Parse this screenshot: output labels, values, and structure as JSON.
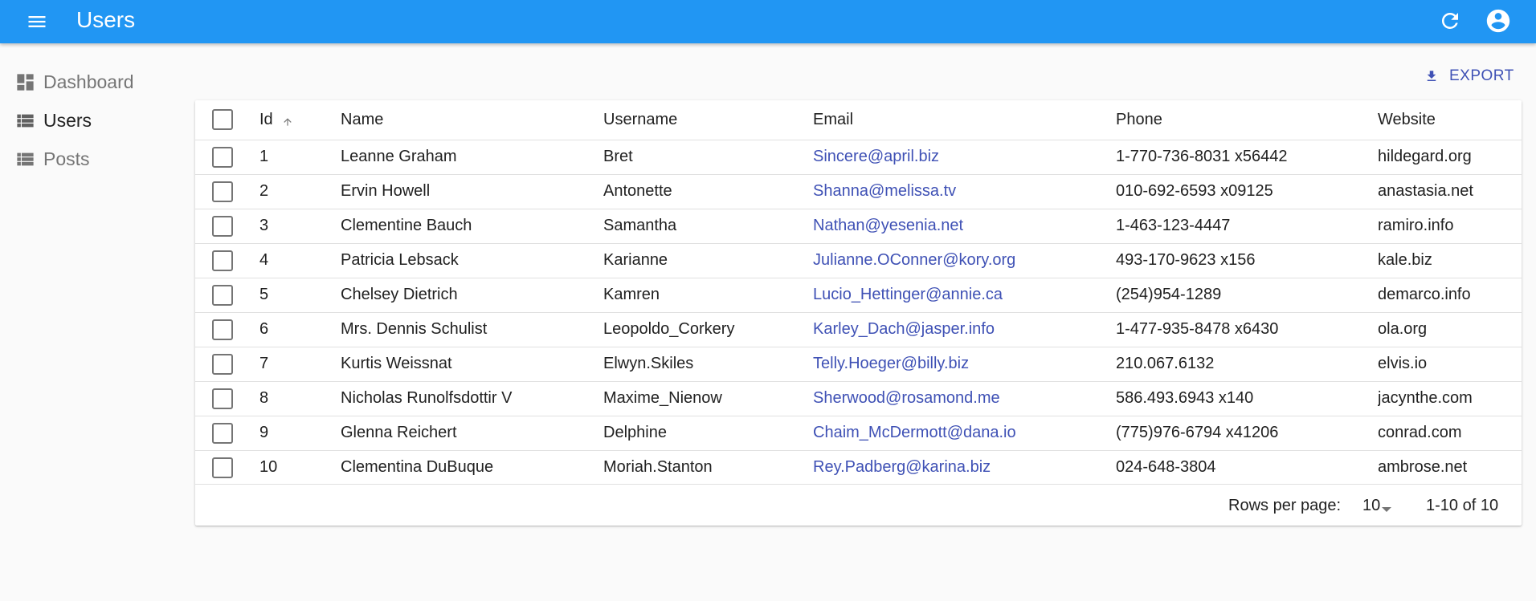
{
  "app": {
    "title": "Users",
    "icons": {
      "menu": "menu-icon",
      "refresh": "refresh-icon",
      "account": "account-circle-icon"
    },
    "colors": {
      "appbar": "#2196f3",
      "link": "#3f51b5"
    }
  },
  "sidebar": {
    "items": [
      {
        "label": "Dashboard",
        "icon": "dashboard-icon",
        "active": false
      },
      {
        "label": "Users",
        "icon": "list-icon",
        "active": true
      },
      {
        "label": "Posts",
        "icon": "list-icon",
        "active": false
      }
    ]
  },
  "toolbar": {
    "export_label": "EXPORT",
    "export_icon": "download-icon"
  },
  "table": {
    "headers": {
      "id": "Id",
      "name": "Name",
      "username": "Username",
      "email": "Email",
      "phone": "Phone",
      "website": "Website"
    },
    "sort": {
      "column": "id",
      "direction": "ascending"
    },
    "rows": [
      {
        "id": "1",
        "name": "Leanne Graham",
        "username": "Bret",
        "email": "Sincere@april.biz",
        "phone": "1-770-736-8031 x56442",
        "website": "hildegard.org"
      },
      {
        "id": "2",
        "name": "Ervin Howell",
        "username": "Antonette",
        "email": "Shanna@melissa.tv",
        "phone": "010-692-6593 x09125",
        "website": "anastasia.net"
      },
      {
        "id": "3",
        "name": "Clementine Bauch",
        "username": "Samantha",
        "email": "Nathan@yesenia.net",
        "phone": "1-463-123-4447",
        "website": "ramiro.info"
      },
      {
        "id": "4",
        "name": "Patricia Lebsack",
        "username": "Karianne",
        "email": "Julianne.OConner@kory.org",
        "phone": "493-170-9623 x156",
        "website": "kale.biz"
      },
      {
        "id": "5",
        "name": "Chelsey Dietrich",
        "username": "Kamren",
        "email": "Lucio_Hettinger@annie.ca",
        "phone": "(254)954-1289",
        "website": "demarco.info"
      },
      {
        "id": "6",
        "name": "Mrs. Dennis Schulist",
        "username": "Leopoldo_Corkery",
        "email": "Karley_Dach@jasper.info",
        "phone": "1-477-935-8478 x6430",
        "website": "ola.org"
      },
      {
        "id": "7",
        "name": "Kurtis Weissnat",
        "username": "Elwyn.Skiles",
        "email": "Telly.Hoeger@billy.biz",
        "phone": "210.067.6132",
        "website": "elvis.io"
      },
      {
        "id": "8",
        "name": "Nicholas Runolfsdottir V",
        "username": "Maxime_Nienow",
        "email": "Sherwood@rosamond.me",
        "phone": "586.493.6943 x140",
        "website": "jacynthe.com"
      },
      {
        "id": "9",
        "name": "Glenna Reichert",
        "username": "Delphine",
        "email": "Chaim_McDermott@dana.io",
        "phone": "(775)976-6794 x41206",
        "website": "conrad.com"
      },
      {
        "id": "10",
        "name": "Clementina DuBuque",
        "username": "Moriah.Stanton",
        "email": "Rey.Padberg@karina.biz",
        "phone": "024-648-3804",
        "website": "ambrose.net"
      }
    ]
  },
  "pagination": {
    "rows_per_page_label": "Rows per page:",
    "rows_per_page_value": "10",
    "range_label": "1-10 of 10"
  }
}
